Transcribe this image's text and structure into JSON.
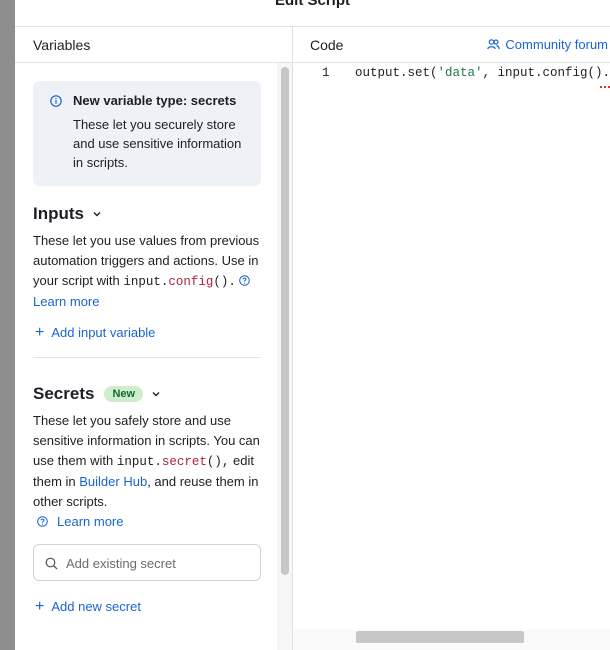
{
  "dialog": {
    "title": "Edit Script"
  },
  "headers": {
    "variables": "Variables",
    "code": "Code",
    "community_forum": "Community forum"
  },
  "info_box": {
    "title": "New variable type: secrets",
    "body": "These let you securely store and use sensitive information in scripts."
  },
  "inputs": {
    "heading": "Inputs",
    "desc_1": "These let you use values from previous automation triggers and actions. Use in your script with ",
    "code_obj": "input.",
    "code_fn": "config",
    "code_parens": "().",
    "learn_more": "Learn more",
    "add_label": "Add input variable"
  },
  "secrets": {
    "heading": "Secrets",
    "badge": "New",
    "desc_1": "These let you safely store and use sensitive information in scripts. You can use them with ",
    "code_obj": "input.",
    "code_fn": "secret",
    "code_parens": "(),",
    "desc_2": " edit them in ",
    "builder_hub": "Builder Hub",
    "desc_3": ", and reuse them in other scripts.",
    "learn_more": "Learn more",
    "search_placeholder": "Add existing secret",
    "add_label": "Add new secret"
  },
  "code": {
    "line_number": "1",
    "part_a": "output.set(",
    "part_str": "'data'",
    "part_b": ", input.config().a"
  },
  "colors": {
    "link": "#1a63d4",
    "keyword": "#b0223d",
    "badge_bg": "#cdeecd",
    "badge_fg": "#166b2c",
    "info_bg": "#eef1f6"
  }
}
